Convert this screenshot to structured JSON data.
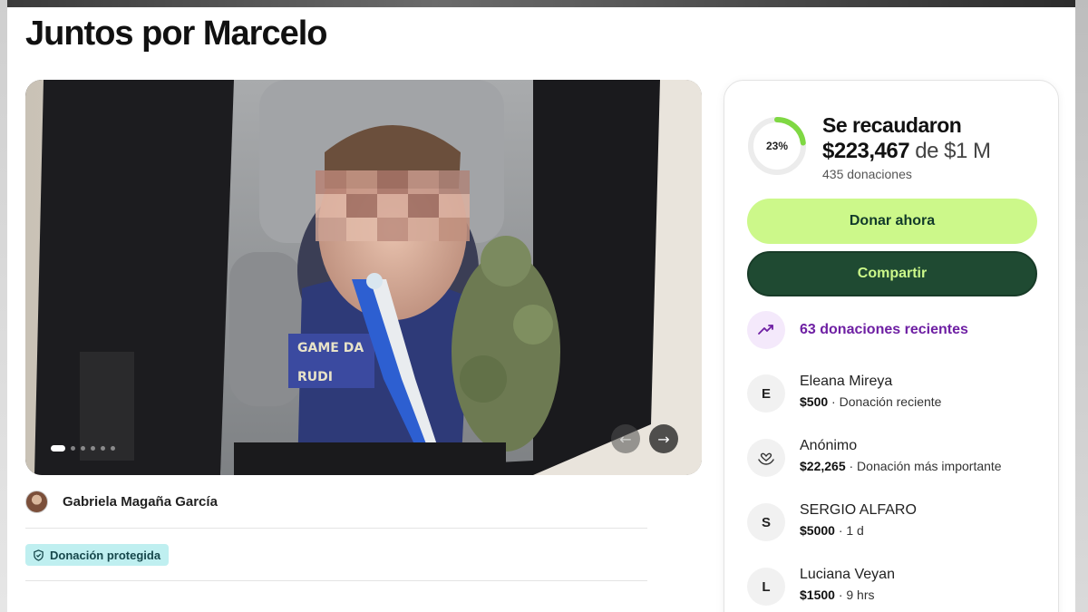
{
  "page": {
    "title": "Juntos por Marcelo"
  },
  "gallery": {
    "slide_count": 6,
    "active_slide": 1
  },
  "organizer": {
    "name": "Gabriela Magaña García"
  },
  "badge": {
    "protected_label": "Donación protegida",
    "icon": "shield-icon"
  },
  "fundraiser": {
    "progress_percent": 23,
    "progress_label": "23%",
    "raised_label": "Se recaudaron",
    "raised_amount": "$223,467",
    "goal_text": "de $1 M",
    "donations_count": "435 donaciones",
    "donate_label": "Donar ahora",
    "share_label": "Compartir",
    "recent_label": "63 donaciones recientes",
    "recent_icon": "trending-up-icon"
  },
  "donations": [
    {
      "initial": "E",
      "name": "Eleana Mireya",
      "amount": "$500",
      "detail": "· Donación reciente"
    },
    {
      "initial": "",
      "icon": "heart-hands-icon",
      "name": "Anónimo",
      "amount": "$22,265",
      "detail": "· Donación más importante"
    },
    {
      "initial": "S",
      "name": "SERGIO ALFARO",
      "amount": "$5000",
      "detail": "· 1 d"
    },
    {
      "initial": "L",
      "name": "Luciana Veyan",
      "amount": "$1500",
      "detail": "· 9 hrs"
    }
  ],
  "colors": {
    "donate_button": "#ccf88a",
    "share_button": "#1f4a32",
    "progress_ring": "#7fd843",
    "recent_accent": "#6e1fa3",
    "badge_bg": "#bfeff0"
  }
}
